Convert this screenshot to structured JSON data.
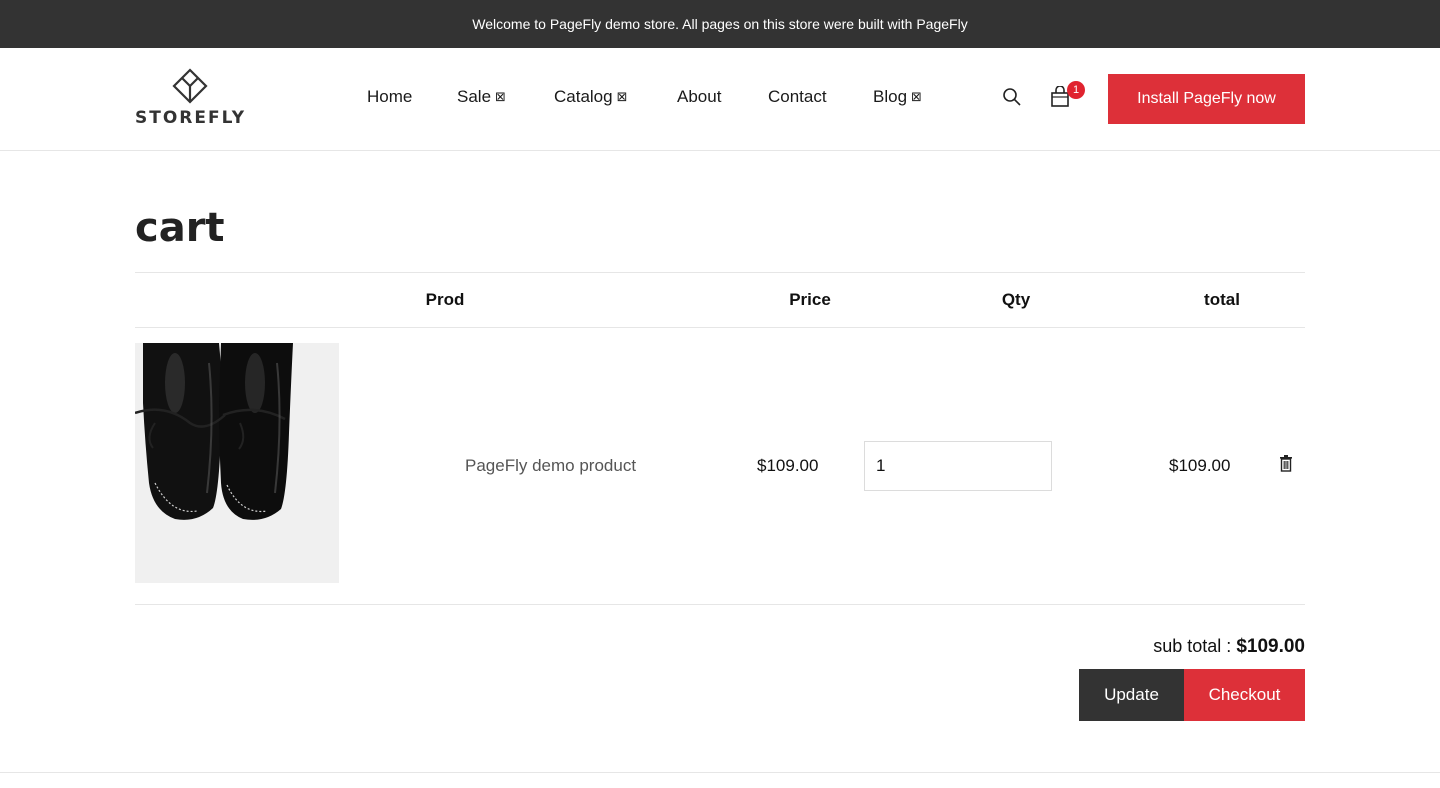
{
  "announcement": "Welcome to PageFly demo store. All pages on this store were built with PageFly",
  "logo": {
    "text": "STOREFLY"
  },
  "nav": {
    "items": [
      {
        "label": "Home",
        "dropdown": false
      },
      {
        "label": "Sale",
        "dropdown": true
      },
      {
        "label": "Catalog",
        "dropdown": true
      },
      {
        "label": "About",
        "dropdown": false
      },
      {
        "label": "Contact",
        "dropdown": false
      },
      {
        "label": "Blog",
        "dropdown": true
      }
    ],
    "dropdown_glyph": "⊠"
  },
  "header": {
    "cart_count": "1",
    "install_label": "Install PageFly now"
  },
  "cart": {
    "title": "cart",
    "columns": {
      "product": "Prod",
      "price": "Price",
      "qty": "Qty",
      "total": "total"
    },
    "items": [
      {
        "name": "PageFly demo product",
        "price": "$109.00",
        "qty": "1",
        "total": "$109.00"
      }
    ],
    "subtotal_label": "sub total : ",
    "subtotal_value": "$109.00",
    "update_label": "Update",
    "checkout_label": "Checkout"
  },
  "colors": {
    "accent": "#dd3039",
    "dark": "#333333",
    "badge": "#e0232f"
  }
}
